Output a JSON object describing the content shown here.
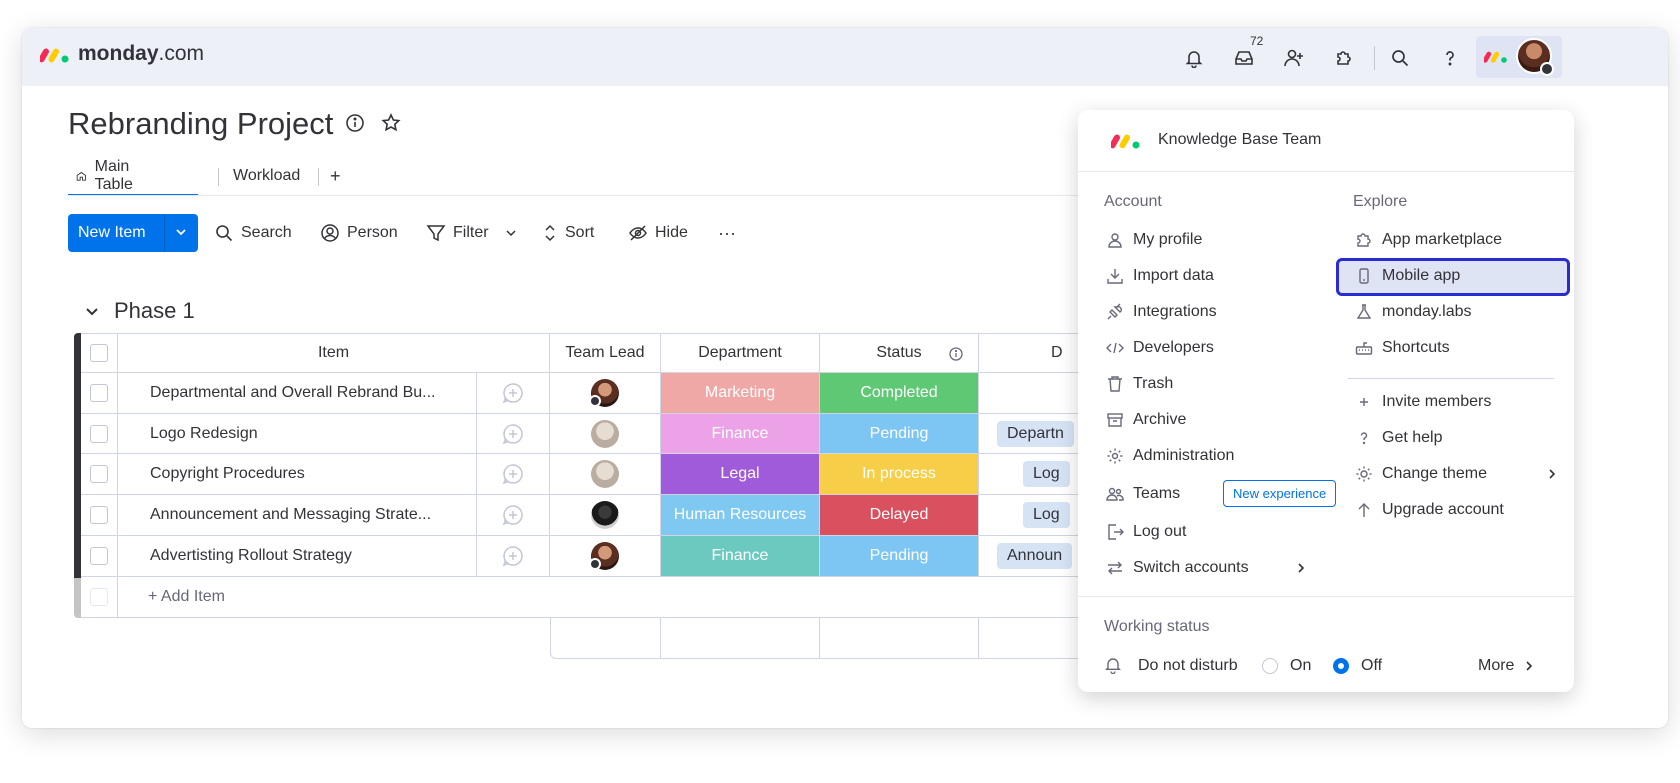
{
  "app": {
    "logo_bold": "monday",
    "logo_suffix": ".com"
  },
  "topbar": {
    "inbox_count": "72"
  },
  "board": {
    "title": "Rebranding Project",
    "tabs": [
      "Main Table",
      "Workload",
      "+"
    ]
  },
  "toolbar": {
    "new_item": "New Item",
    "search": "Search",
    "person": "Person",
    "filter": "Filter",
    "sort": "Sort",
    "hide": "Hide",
    "more": "···"
  },
  "group": {
    "title": "Phase 1"
  },
  "table": {
    "headers": {
      "item": "Item",
      "team_lead": "Team Lead",
      "department": "Department",
      "status": "Status",
      "date_partial": "D"
    },
    "rows": [
      {
        "item": "Departmental and Overall Rebrand Bu...",
        "department": "Marketing",
        "dept_color": "#f0a8a6",
        "status": "Completed",
        "status_color": "#5ec875",
        "extra": ""
      },
      {
        "item": "Logo Redesign",
        "department": "Finance",
        "dept_color": "#eba2e6",
        "status": "Pending",
        "status_color": "#7dc6f4",
        "extra": "Departn"
      },
      {
        "item": "Copyright Procedures",
        "department": "Legal",
        "dept_color": "#9f5bd9",
        "status": "In process",
        "status_color": "#f6ce47",
        "extra": "Log"
      },
      {
        "item": "Announcement and Messaging Strate...",
        "department": "Human Resources",
        "dept_color": "#7fc8f2",
        "status": "Delayed",
        "status_color": "#d9505f",
        "extra": "Log"
      },
      {
        "item": "Advertisting Rollout Strategy",
        "department": "Finance",
        "dept_color": "#6bc9c0",
        "status": "Pending",
        "status_color": "#7dc6f4",
        "extra": "Announ"
      }
    ],
    "add_item": "+ Add Item"
  },
  "menu": {
    "team": "Knowledge Base Team",
    "account_title": "Account",
    "account_items": [
      "My profile",
      "Import data",
      "Integrations",
      "Developers",
      "Trash",
      "Archive",
      "Administration",
      "Teams",
      "Log out",
      "Switch accounts"
    ],
    "teams_badge": "New experience",
    "explore_title": "Explore",
    "explore_items": [
      "App marketplace",
      "Mobile app",
      "monday.labs",
      "Shortcuts"
    ],
    "extra_items": [
      "Invite members",
      "Get help",
      "Change theme",
      "Upgrade account"
    ],
    "working_status": {
      "title": "Working status",
      "label": "Do not disturb",
      "on": "On",
      "off": "Off",
      "selected": "Off",
      "more": "More"
    }
  },
  "colors": {
    "accent": "#0073ea",
    "highlight_border": "#2b2bd4"
  }
}
